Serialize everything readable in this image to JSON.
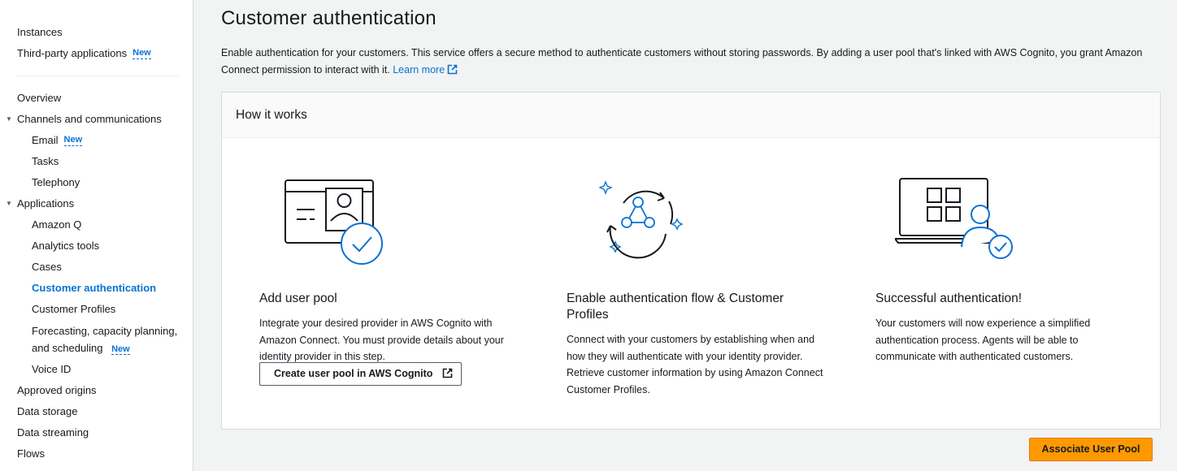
{
  "sidebar": {
    "top_items": [
      {
        "label": "Instances"
      },
      {
        "label": "Third-party applications",
        "badge": "New"
      }
    ],
    "overview": "Overview",
    "channels": {
      "label": "Channels and communications",
      "items": [
        {
          "label": "Email",
          "badge": "New"
        },
        {
          "label": "Tasks"
        },
        {
          "label": "Telephony"
        }
      ]
    },
    "applications": {
      "label": "Applications",
      "items": [
        {
          "label": "Amazon Q"
        },
        {
          "label": "Analytics tools"
        },
        {
          "label": "Cases"
        },
        {
          "label": "Customer authentication"
        },
        {
          "label": "Customer Profiles"
        },
        {
          "label_line1": "Forecasting, capacity planning,",
          "label_line2": "and scheduling",
          "badge": "New"
        },
        {
          "label": "Voice ID"
        }
      ]
    },
    "bottom_items": [
      {
        "label": "Approved origins"
      },
      {
        "label": "Data storage"
      },
      {
        "label": "Data streaming"
      },
      {
        "label": "Flows"
      }
    ]
  },
  "page": {
    "title": "Customer authentication",
    "description": "Enable authentication for your customers. This service offers a secure method to authenticate customers without storing passwords. By adding a user pool that's linked with AWS Cognito, you grant Amazon Connect permission to interact with it.",
    "learn_more": "Learn more"
  },
  "how_it_works": {
    "header": "How it works",
    "steps": [
      {
        "title": "Add user pool",
        "description": "Integrate your desired provider in AWS Cognito with Amazon Connect. You must provide details about your identity provider in this step.",
        "button": "Create user pool in AWS Cognito"
      },
      {
        "title": "Enable authentication flow & Customer Profiles",
        "description": "Connect with your customers by establishing when and how they will authenticate with your identity provider. Retrieve customer information by using Amazon Connect Customer Profiles."
      },
      {
        "title": "Successful authentication!",
        "description": "Your customers will now experience a simplified authentication process. Agents will be able to communicate with authenticated customers."
      }
    ]
  },
  "actions": {
    "associate": "Associate User Pool"
  },
  "colors": {
    "accent": "#0972d3",
    "primary_button": "#ff9900",
    "background": "#f2f3f3"
  }
}
